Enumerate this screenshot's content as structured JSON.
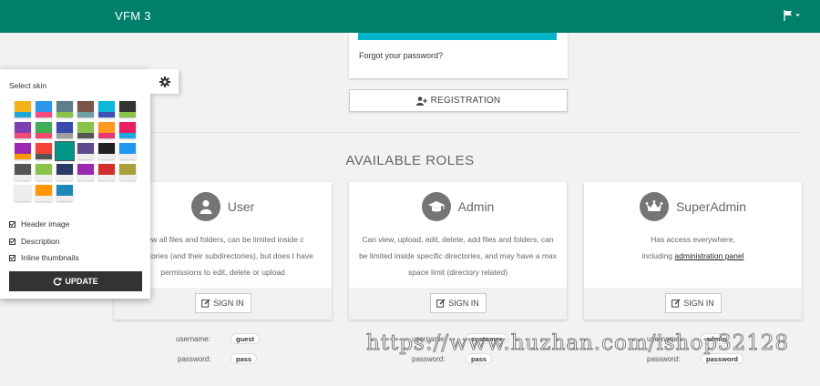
{
  "navbar": {
    "brand": "VFM 3",
    "language_icon": "flag-icon"
  },
  "login": {
    "forgot_password": "Forgot your password?"
  },
  "registration": {
    "label": "REGISTRATION",
    "icon": "user-plus-icon"
  },
  "roles": {
    "title": "AVAILABLE ROLES",
    "items": [
      {
        "name": "User",
        "icon": "user-icon",
        "description": "view all files and folders, can be limited inside c directories (and their subdirectories), but does t have permissions to edit, delete or upload",
        "signin": "SIGN IN",
        "username_label": "username:",
        "username": "guest",
        "password_label": "password:",
        "password": "pass"
      },
      {
        "name": "Admin",
        "icon": "graduation-cap-icon",
        "description": "Can view, upload, edit, delete, add files and folders, can be limited inside specific directories, and may have a max space limit (directory related)",
        "signin": "SIGN IN",
        "username_label": "username:",
        "username": "customer",
        "password_label": "password:",
        "password": "pass"
      },
      {
        "name": "SuperAdmin",
        "icon": "crown-icon",
        "description_1": "Has access everywhere,",
        "description_2": "including",
        "link": "administration panel",
        "signin": "SIGN IN",
        "username_label": "username:",
        "username": "admin",
        "password_label": "password:",
        "password": "password"
      }
    ]
  },
  "skin_panel": {
    "label": "Select skin",
    "swatches": [
      [
        "#f2b21a",
        "#1fa8d6"
      ],
      [
        "#2f97e8",
        "#f44a7e"
      ],
      [
        "#607d8b",
        "#8bc34a"
      ],
      [
        "#795548",
        "#6fa0a8"
      ],
      [
        "#10b8d8",
        "#3f51b5"
      ],
      [
        "#333333",
        "#8bc34a"
      ],
      [
        "#7e3fb0",
        "#f04a76"
      ],
      [
        "#3fae56",
        "#f24a6d"
      ],
      [
        "#3a4bb0",
        "#9e9e9e"
      ],
      [
        "#8bc34a",
        "#555555"
      ],
      [
        "#ff9a1f",
        "#e8386f"
      ],
      [
        "#ea1f63",
        "#1ca7e2"
      ],
      [
        "#9c27b0",
        "#ff9800"
      ],
      [
        "#f44336",
        "#555555"
      ],
      [
        "#009688",
        "#009688"
      ],
      [
        "#5e4b8c",
        "#eeeeee"
      ],
      [
        "#222222",
        "#eeeeee"
      ],
      [
        "#2196f3",
        "#eeeeee"
      ],
      [
        "#555555",
        "#eeeeee"
      ],
      [
        "#8bc34a",
        "#eeeeee"
      ],
      [
        "#2b3a66",
        "#eeeeee"
      ],
      [
        "#9c27b0",
        "#eeeeee"
      ],
      [
        "#d32f2f",
        "#eeeeee"
      ],
      [
        "#a8a03a",
        "#eeeeee"
      ],
      [
        "#eeeeee",
        "#eeeeee"
      ],
      [
        "#ff9800",
        "#eeeeee"
      ],
      [
        "#1e88b8",
        "#eeeeee"
      ]
    ],
    "selected_index": 14,
    "options": [
      {
        "label": "Header image",
        "checked": true
      },
      {
        "label": "Description",
        "checked": true
      },
      {
        "label": "Inline thumbnails",
        "checked": true
      }
    ],
    "update_label": "UPDATE",
    "update_icon": "refresh-icon",
    "settings_icon": "gear-icon"
  },
  "watermark": "https://www.huzhan.com/ishop32128",
  "colors": {
    "navbar": "#00806a",
    "accent": "#00b5c8",
    "panel_button": "#333333"
  }
}
